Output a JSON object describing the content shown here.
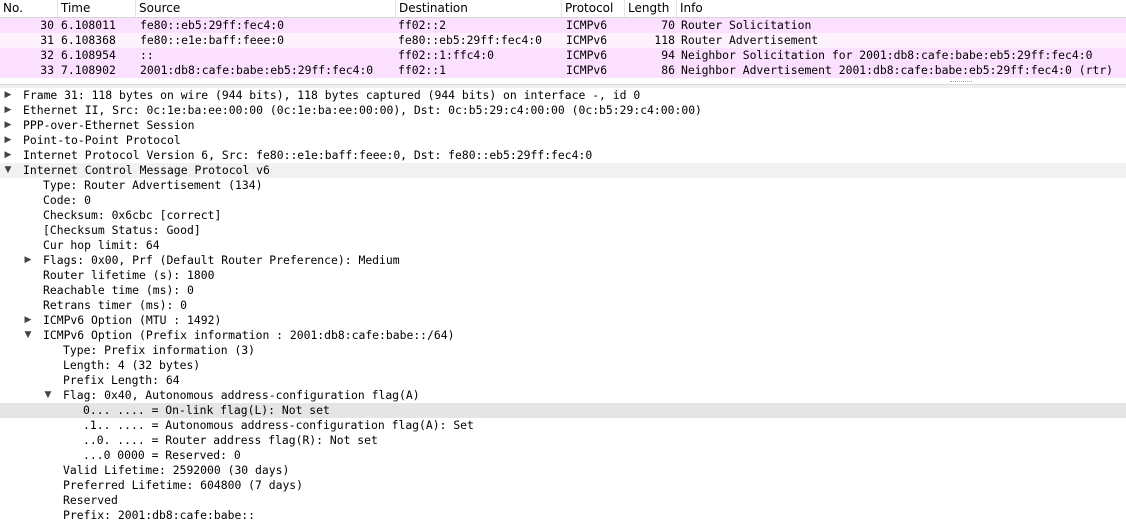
{
  "packet_list": {
    "columns": [
      "No.",
      "Time",
      "Source",
      "Destination",
      "Protocol",
      "Length",
      "Info"
    ],
    "rows": [
      {
        "no": "30",
        "time": "6.108011",
        "source": "fe80::eb5:29ff:fec4:0",
        "destination": "ff02::2",
        "protocol": "ICMPv6",
        "length": "70",
        "info": "Router Solicitation"
      },
      {
        "no": "31",
        "time": "6.108368",
        "source": "fe80::e1e:baff:feee:0",
        "destination": "fe80::eb5:29ff:fec4:0",
        "protocol": "ICMPv6",
        "length": "118",
        "info": "Router Advertisement"
      },
      {
        "no": "32",
        "time": "6.108954",
        "source": "::",
        "destination": "ff02::1:ffc4:0",
        "protocol": "ICMPv6",
        "length": "94",
        "info": "Neighbor Solicitation for 2001:db8:cafe:babe:eb5:29ff:fec4:0"
      },
      {
        "no": "33",
        "time": "7.108902",
        "source": "2001:db8:cafe:babe:eb5:29ff:fec4:0",
        "destination": "ff02::1",
        "protocol": "ICMPv6",
        "length": "86",
        "info": "Neighbor Advertisement 2001:db8:cafe:babe:eb5:29ff:fec4:0 (rtr)"
      }
    ]
  },
  "detail_tree": [
    {
      "text": "Frame 31: 118 bytes on wire (944 bits), 118 bytes captured (944 bits) on interface -, id 0",
      "state": "collapsed"
    },
    {
      "text": "Ethernet II, Src: 0c:1e:ba:ee:00:00 (0c:1e:ba:ee:00:00), Dst: 0c:b5:29:c4:00:00 (0c:b5:29:c4:00:00)",
      "state": "collapsed"
    },
    {
      "text": "PPP-over-Ethernet Session",
      "state": "collapsed"
    },
    {
      "text": "Point-to-Point Protocol",
      "state": "collapsed"
    },
    {
      "text": "Internet Protocol Version 6, Src: fe80::e1e:baff:feee:0, Dst: fe80::eb5:29ff:fec4:0",
      "state": "collapsed"
    },
    {
      "text": "Internet Control Message Protocol v6",
      "state": "expanded"
    },
    {
      "text": "Type: Router Advertisement (134)",
      "state": "leaf"
    },
    {
      "text": "Code: 0",
      "state": "leaf"
    },
    {
      "text": "Checksum: 0x6cbc [correct]",
      "state": "leaf"
    },
    {
      "text": "[Checksum Status: Good]",
      "state": "leaf"
    },
    {
      "text": "Cur hop limit: 64",
      "state": "leaf"
    },
    {
      "text": "Flags: 0x00, Prf (Default Router Preference): Medium",
      "state": "collapsed"
    },
    {
      "text": "Router lifetime (s): 1800",
      "state": "leaf"
    },
    {
      "text": "Reachable time (ms): 0",
      "state": "leaf"
    },
    {
      "text": "Retrans timer (ms): 0",
      "state": "leaf"
    },
    {
      "text": "ICMPv6 Option (MTU : 1492)",
      "state": "collapsed"
    },
    {
      "text": "ICMPv6 Option (Prefix information : 2001:db8:cafe:babe::/64)",
      "state": "expanded"
    },
    {
      "text": "Type: Prefix information (3)",
      "state": "leaf"
    },
    {
      "text": "Length: 4 (32 bytes)",
      "state": "leaf"
    },
    {
      "text": "Prefix Length: 64",
      "state": "leaf"
    },
    {
      "text": "Flag: 0x40, Autonomous address-configuration flag(A)",
      "state": "expanded"
    },
    {
      "text": "0... .... = On-link flag(L): Not set",
      "state": "leaf"
    },
    {
      "text": ".1.. .... = Autonomous address-configuration flag(A): Set",
      "state": "leaf"
    },
    {
      "text": "..0. .... = Router address flag(R): Not set",
      "state": "leaf"
    },
    {
      "text": "...0 0000 = Reserved: 0",
      "state": "leaf"
    },
    {
      "text": "Valid Lifetime: 2592000 (30 days)",
      "state": "leaf"
    },
    {
      "text": "Preferred Lifetime: 604800 (7 days)",
      "state": "leaf"
    },
    {
      "text": "Reserved",
      "state": "leaf"
    },
    {
      "text": "Prefix: 2001:db8:cafe:babe::",
      "state": "leaf"
    }
  ],
  "colors": {
    "icmp_row": "#fce0ff",
    "selected_detail": "#e5e5e5"
  },
  "icons": {
    "collapsed": "triangle-right-icon",
    "expanded": "triangle-down-icon"
  }
}
